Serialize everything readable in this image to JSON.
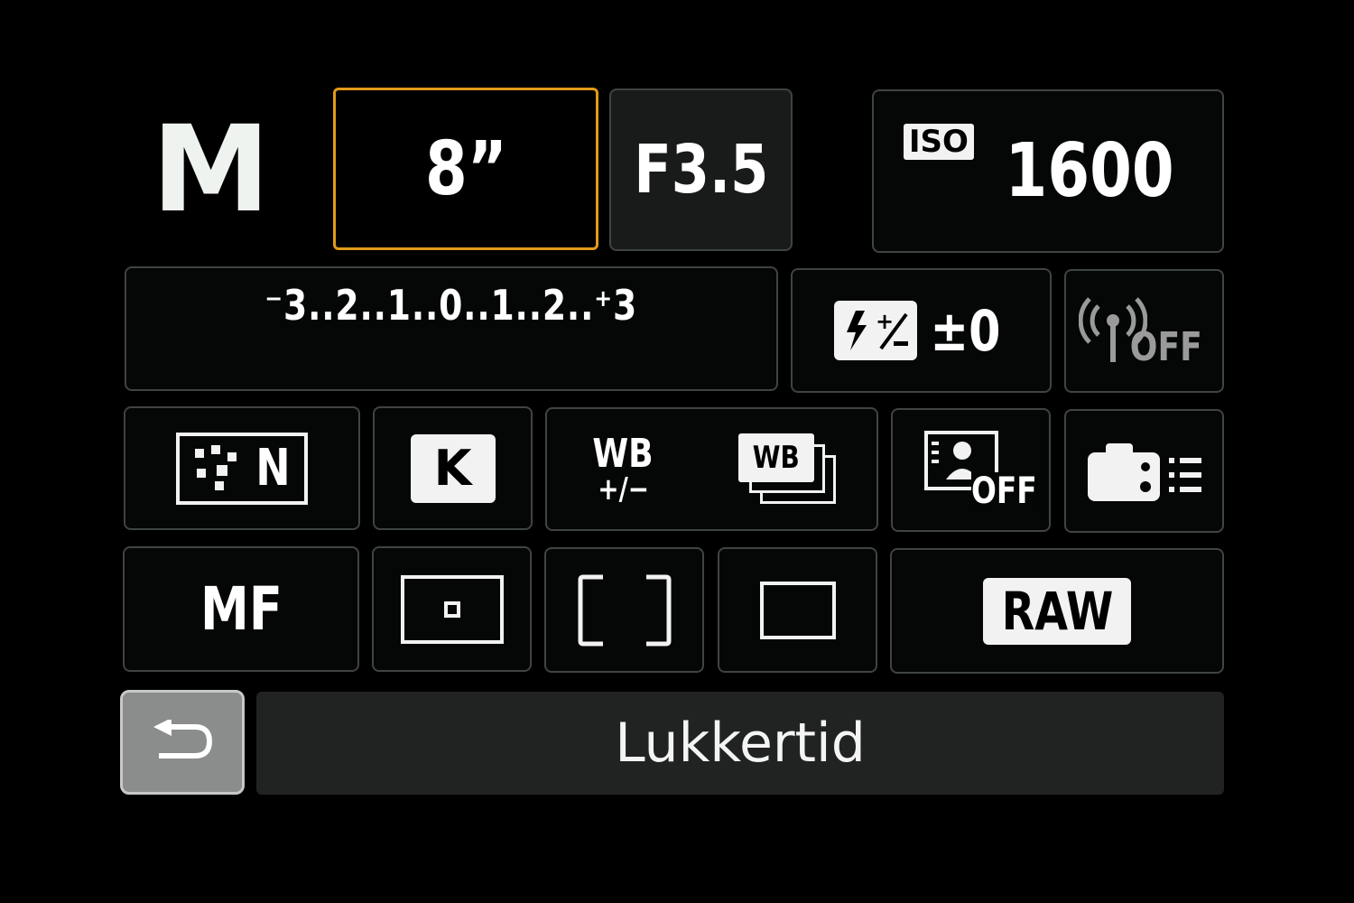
{
  "mode": "M",
  "shutter_speed": "8”",
  "aperture": "F3.5",
  "iso": {
    "badge": "ISO",
    "value": "1600"
  },
  "exposure_scale": "⁻3..2..1..0..1..2..⁺3",
  "flash_comp": {
    "icon": "flash-exposure-compensation-icon",
    "value": "±0"
  },
  "wifi": {
    "icon": "wireless-signal-icon",
    "state": "OFF"
  },
  "row3": {
    "picture_style": {
      "icon": "picture-style-icon",
      "label": "N"
    },
    "white_balance": "K",
    "wb_shift": {
      "line1": "WB",
      "line2": "+/−"
    },
    "wb_bracket": {
      "icon": "white-balance-bracketing-icon",
      "label": "WB"
    },
    "auto_lighting_optimizer": {
      "icon": "auto-lighting-optimizer-icon",
      "state": "OFF"
    },
    "custom_controls": {
      "icon": "camera-settings-list-icon"
    }
  },
  "row4": {
    "focus_mode": "MF",
    "metering": {
      "icon": "spot-metering-icon"
    },
    "af_area": {
      "icon": "af-area-bracket-icon"
    },
    "aspect": {
      "icon": "full-frame-aspect-icon"
    },
    "image_quality": "RAW"
  },
  "footer": {
    "back_icon": "return-arrow-icon",
    "status_text": "Lukkertid"
  },
  "colors": {
    "selection": "#e19a1a",
    "background": "#000000",
    "cell_border": "#3f4442",
    "status_bar": "#212322",
    "back_button": "#8a8d8b"
  }
}
